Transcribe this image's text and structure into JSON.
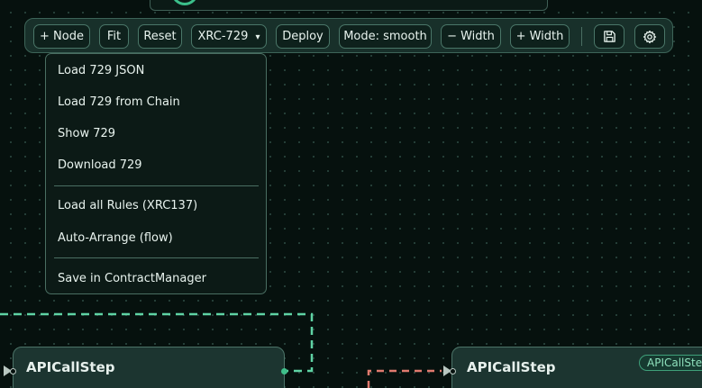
{
  "toolbar": {
    "add_node": "+ Node",
    "fit": "Fit",
    "reset": "Reset",
    "standard_select": "XRC-729",
    "deploy": "Deploy",
    "mode": "Mode: smooth",
    "width_minus": "− Width",
    "width_plus": "+ Width",
    "icons": [
      "save-icon",
      "gear-icon"
    ],
    "caret": "▾"
  },
  "menu": {
    "items": [
      "Load 729 JSON",
      "Load 729 from Chain",
      "Show 729",
      "Download 729",
      "Load all Rules (XRC137)",
      "Auto-Arrange (flow)",
      "Save in ContractManager"
    ]
  },
  "nodes": [
    {
      "title": "APICallStep",
      "badge": ""
    },
    {
      "title": "APICallStep",
      "badge": "APICallStep"
    }
  ],
  "colors": {
    "accent": "#3fbf8a",
    "edge_green": "#5fd3a4",
    "edge_red": "#e07a6e",
    "canvas": "#06110e",
    "toolbar_bg": "#18302a"
  }
}
